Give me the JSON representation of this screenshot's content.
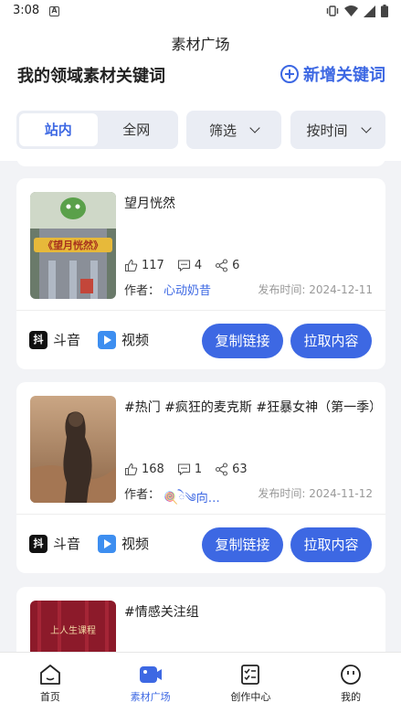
{
  "status_bar": {
    "time": "3:08",
    "notif_glyph": "A",
    "icons": [
      "vibrate-icon",
      "wifi-icon",
      "signal-icon",
      "battery-icon"
    ]
  },
  "header": {
    "title": "素材广场"
  },
  "section": {
    "title": "我的领域素材关键词",
    "add_label": "新增关键词"
  },
  "filters": {
    "scope_options": [
      "站内",
      "全网"
    ],
    "scope_selected": "站内",
    "filter_label": "筛选",
    "sort_label": "按时间"
  },
  "cards": [
    {
      "title": "望月恍然",
      "likes": "117",
      "comments": "4",
      "shares": "6",
      "author_label": "作者：",
      "author": "心动奶昔",
      "publish_time": "发布时间: 2024-12-11",
      "platform": "斗音",
      "type": "视频",
      "copy_label": "复制链接",
      "pull_label": "拉取内容",
      "thumb_text": "《望月恍然》"
    },
    {
      "title": "#热门 #疯狂的麦克斯 #狂暴女神（第一季）",
      "likes": "168",
      "comments": "1",
      "shares": "63",
      "author_label": "作者：",
      "author": "🍭ེ༄向…",
      "publish_time": "发布时间: 2024-11-12",
      "platform": "斗音",
      "type": "视频",
      "copy_label": "复制链接",
      "pull_label": "拉取内容"
    },
    {
      "title": "#情感关注组",
      "thumb_text": "上人生课程"
    }
  ],
  "tabbar": [
    {
      "label": "首页",
      "icon": "home-icon"
    },
    {
      "label": "素材广场",
      "icon": "material-square-icon",
      "active": true
    },
    {
      "label": "创作中心",
      "icon": "creation-center-icon"
    },
    {
      "label": "我的",
      "icon": "profile-icon"
    }
  ],
  "colors": {
    "accent": "#3d68e3",
    "background": "#f2f3f6"
  }
}
